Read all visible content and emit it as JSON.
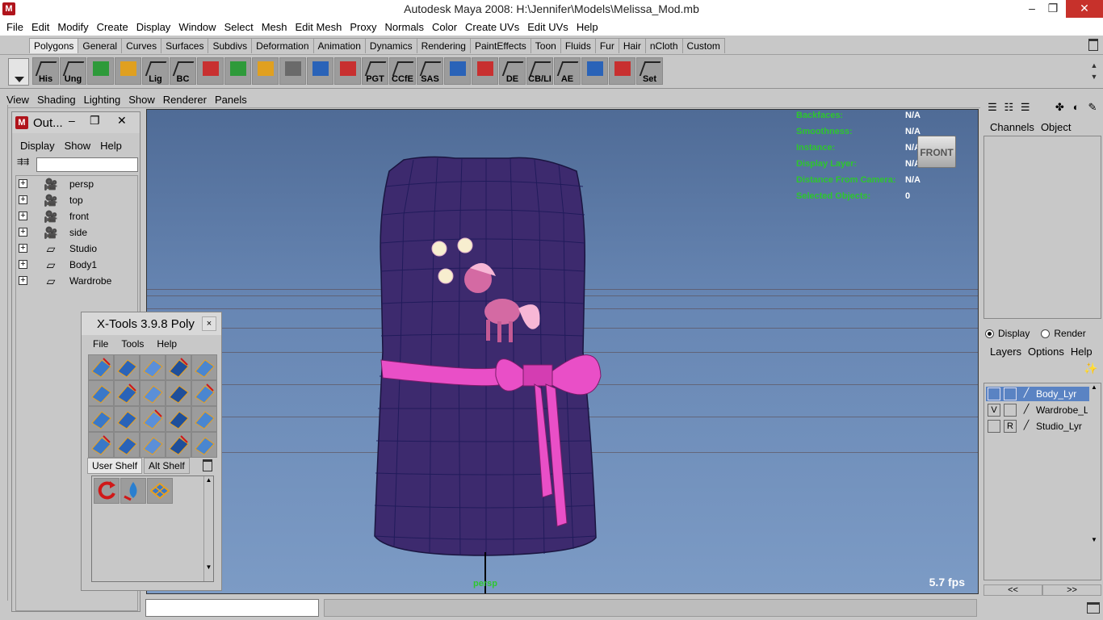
{
  "window": {
    "title": "Autodesk Maya 2008: H:\\Jennifer\\Models\\Melissa_Mod.mb",
    "minimize": "–",
    "maximize": "❐",
    "close": "✕"
  },
  "menubar": [
    "File",
    "Edit",
    "Modify",
    "Create",
    "Display",
    "Window",
    "Select",
    "Mesh",
    "Edit Mesh",
    "Proxy",
    "Normals",
    "Color",
    "Create UVs",
    "Edit UVs",
    "Help"
  ],
  "shelf_tabs": [
    "Polygons",
    "General",
    "Curves",
    "Surfaces",
    "Subdivs",
    "Deformation",
    "Animation",
    "Dynamics",
    "Rendering",
    "PaintEffects",
    "Toon",
    "Fluids",
    "Fur",
    "Hair",
    "nCloth",
    "Custom"
  ],
  "shelf_active_tab": "Polygons",
  "shelf_icons": [
    {
      "label": "His",
      "icon": "history-icon"
    },
    {
      "label": "Ung",
      "icon": "ungroup-icon"
    },
    {
      "label": "",
      "icon": "cube-blue-icon"
    },
    {
      "label": "",
      "icon": "sphere-green-icon"
    },
    {
      "label": "Lig",
      "icon": "light-icon"
    },
    {
      "label": "BC",
      "icon": "bc-icon"
    },
    {
      "label": "",
      "icon": "uv-target-icon"
    },
    {
      "label": "",
      "icon": "redo-red-icon"
    },
    {
      "label": "",
      "icon": "spider-icon"
    },
    {
      "label": "",
      "icon": "mesh-select-icon"
    },
    {
      "label": "",
      "icon": "axes-icon"
    },
    {
      "label": "",
      "icon": "curve-icon"
    },
    {
      "label": "PGT",
      "icon": "pgt-icon"
    },
    {
      "label": "CCfE",
      "icon": "ccfe-icon"
    },
    {
      "label": "SAS",
      "icon": "sas-icon"
    },
    {
      "label": "",
      "icon": "plane-blue-icon"
    },
    {
      "label": "",
      "icon": "tiles-icon"
    },
    {
      "label": "DE",
      "icon": "de-icon"
    },
    {
      "label": "CB/LI",
      "icon": "cbli-icon"
    },
    {
      "label": "AE",
      "icon": "ae-icon"
    },
    {
      "label": "",
      "icon": "cylinder-icon"
    },
    {
      "label": "",
      "icon": "path-icon"
    },
    {
      "label": "Set",
      "icon": "key-icon"
    }
  ],
  "panel_menu": [
    "View",
    "Shading",
    "Lighting",
    "Show",
    "Renderer",
    "Panels"
  ],
  "viewport": {
    "hud": [
      {
        "key": "Backfaces:",
        "value": "N/A"
      },
      {
        "key": "Smoothness:",
        "value": "N/A"
      },
      {
        "key": "Instance:",
        "value": "N/A"
      },
      {
        "key": "Display Layer:",
        "value": "N/A"
      },
      {
        "key": "Distance From Camera:",
        "value": "N/A"
      },
      {
        "key": "Selected Objects:",
        "value": "0"
      }
    ],
    "viewcube": "FRONT",
    "fps": "5.7 fps",
    "camera": "persp"
  },
  "outliner": {
    "title": "Out...",
    "menu": [
      "Display",
      "Show",
      "Help"
    ],
    "filter_value": "",
    "items": [
      {
        "name": "persp",
        "type": "camera"
      },
      {
        "name": "top",
        "type": "camera"
      },
      {
        "name": "front",
        "type": "camera"
      },
      {
        "name": "side",
        "type": "camera"
      },
      {
        "name": "Studio",
        "type": "mesh"
      },
      {
        "name": "Body1",
        "type": "mesh"
      },
      {
        "name": "Wardrobe",
        "type": "mesh"
      }
    ]
  },
  "xtools": {
    "title": "X-Tools 3.9.8 Poly",
    "close": "×",
    "menu": [
      "File",
      "Tools",
      "Help"
    ],
    "tabs": [
      "User Shelf",
      "Alt Shelf"
    ],
    "active_tab": "User Shelf"
  },
  "right_panel": {
    "tabs": [
      "Channels",
      "Object"
    ],
    "radio": [
      {
        "label": "Display",
        "on": true
      },
      {
        "label": "Render",
        "on": false
      }
    ],
    "layer_menu": [
      "Layers",
      "Options",
      "Help"
    ],
    "layers": [
      {
        "v": "",
        "r": "",
        "name": "Body_Lyr",
        "selected": true
      },
      {
        "v": "V",
        "r": "",
        "name": "Wardrobe_Lyr",
        "selected": false
      },
      {
        "v": "",
        "r": "R",
        "name": "Studio_Lyr",
        "selected": false
      }
    ],
    "nav": [
      "<<",
      ">>"
    ]
  },
  "colors": {
    "hud_key": "#2ec62e",
    "viewport_bg": "#6786b3",
    "garment": "#3d2a6e",
    "sash": "#e94fc7",
    "selection": "#5a83c3"
  }
}
